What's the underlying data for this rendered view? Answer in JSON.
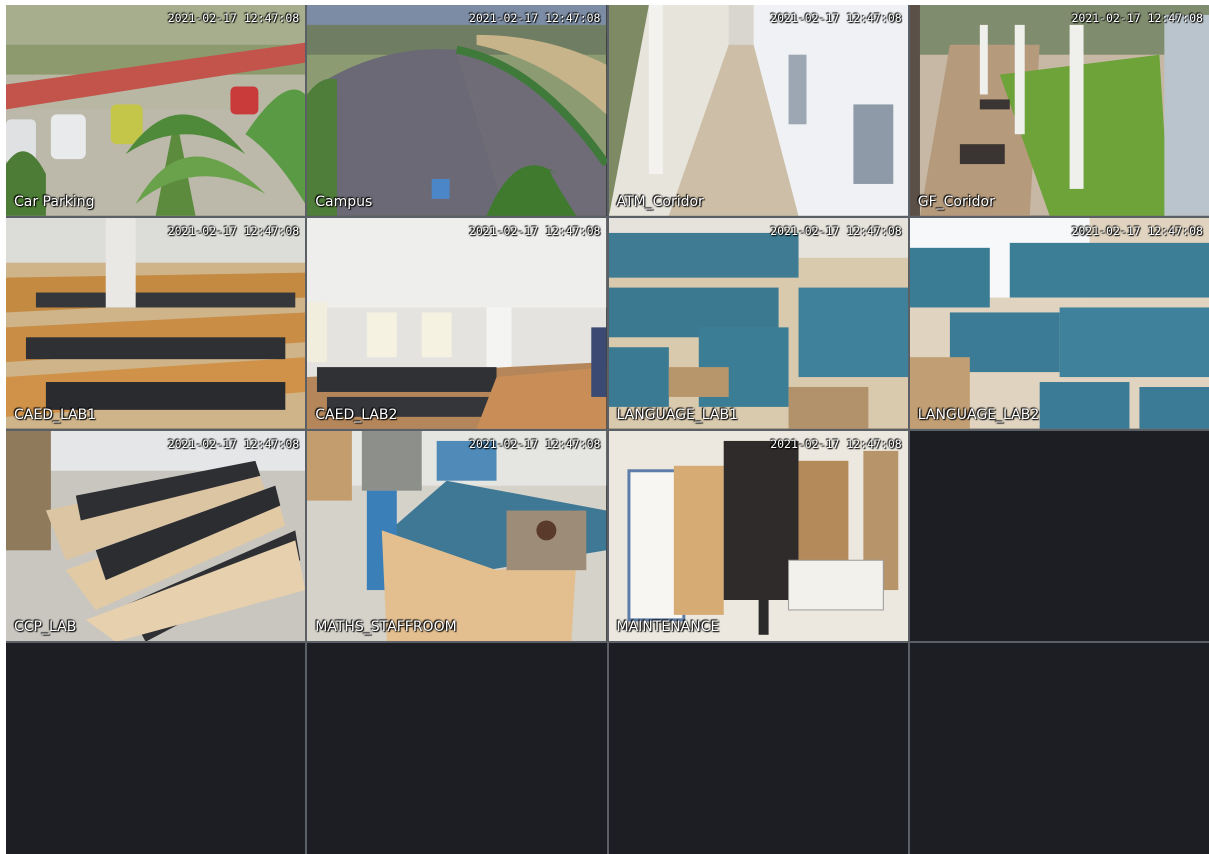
{
  "cameras": [
    {
      "label": "Car Parking",
      "timestamp": "2021-02-17 12:47:08",
      "scene": "parking-scene"
    },
    {
      "label": "Campus",
      "timestamp": "2021-02-17 12:47:08",
      "scene": "campus-scene"
    },
    {
      "label": "ATM_Coridor",
      "timestamp": "2021-02-17 12:47:08",
      "scene": "corridor-scene"
    },
    {
      "label": "GF_Coridor",
      "timestamp": "2021-02-17 12:47:08",
      "scene": "corridor-lawn-scene"
    },
    {
      "label": "CAED_LAB1",
      "timestamp": "2021-02-17 12:47:08",
      "scene": "computer-lab-scene"
    },
    {
      "label": "CAED_LAB2",
      "timestamp": "2021-02-17 12:47:08",
      "scene": "computer-lab-scene"
    },
    {
      "label": "LANGUAGE_LAB1",
      "timestamp": "2021-02-17 12:47:08",
      "scene": "cubicle-lab-scene"
    },
    {
      "label": "LANGUAGE_LAB2",
      "timestamp": "2021-02-17 12:47:08",
      "scene": "cubicle-lab-scene"
    },
    {
      "label": "CCP_LAB",
      "timestamp": "2021-02-17 12:47:08",
      "scene": "computer-lab-scene"
    },
    {
      "label": "MATHS_STAFFROOM",
      "timestamp": "2021-02-17 12:47:08",
      "scene": "staffroom-scene"
    },
    {
      "label": "MAINTENANCE",
      "timestamp": "2021-02-17 12:47:08",
      "scene": "store-room-scene"
    }
  ],
  "empty_slots": 5
}
